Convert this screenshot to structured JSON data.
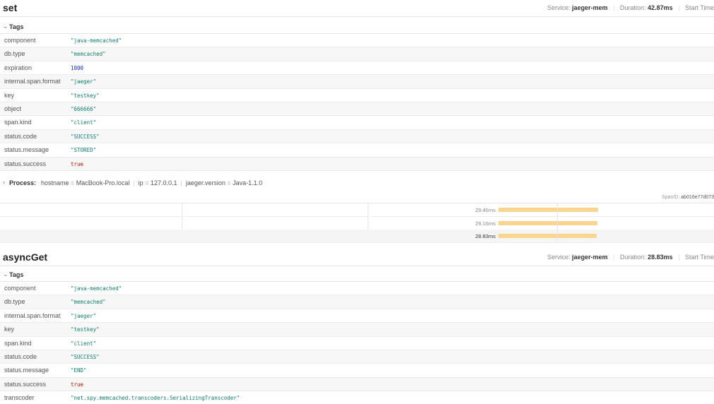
{
  "spans": [
    {
      "title": "set",
      "service_label": "Service:",
      "service": "jaeger-mem",
      "duration_label": "Duration:",
      "duration": "42.87ms",
      "start_label": "Start Time",
      "tags_label": "Tags",
      "tags": [
        {
          "key": "component",
          "value": "\"java-memcached\"",
          "type": "str"
        },
        {
          "key": "db.type",
          "value": "\"memcached\"",
          "type": "str"
        },
        {
          "key": "expiration",
          "value": "1000",
          "type": "num"
        },
        {
          "key": "internal.span.format",
          "value": "\"jaeger\"",
          "type": "str"
        },
        {
          "key": "key",
          "value": "\"testkey\"",
          "type": "str"
        },
        {
          "key": "object",
          "value": "\"666666\"",
          "type": "str"
        },
        {
          "key": "span.kind",
          "value": "\"client\"",
          "type": "str"
        },
        {
          "key": "status.code",
          "value": "\"SUCCESS\"",
          "type": "str"
        },
        {
          "key": "status.message",
          "value": "\"STORED\"",
          "type": "str"
        },
        {
          "key": "status.success",
          "value": "true",
          "type": "bool"
        }
      ],
      "process_label": "Process:",
      "process": [
        {
          "key": "hostname",
          "value": "MacBook-Pro.local"
        },
        {
          "key": "ip",
          "value": "127.0.0.1"
        },
        {
          "key": "jaeger.version",
          "value": "Java-1.1.0"
        }
      ],
      "span_id_label": "SpanID:",
      "span_id": "ab016e77d073"
    },
    {
      "title": "asyncGet",
      "service_label": "Service:",
      "service": "jaeger-mem",
      "duration_label": "Duration:",
      "duration": "28.83ms",
      "start_label": "Start Time",
      "tags_label": "Tags",
      "tags": [
        {
          "key": "component",
          "value": "\"java-memcached\"",
          "type": "str"
        },
        {
          "key": "db.type",
          "value": "\"memcached\"",
          "type": "str"
        },
        {
          "key": "internal.span.format",
          "value": "\"jaeger\"",
          "type": "str"
        },
        {
          "key": "key",
          "value": "\"testkey\"",
          "type": "str"
        },
        {
          "key": "span.kind",
          "value": "\"client\"",
          "type": "str"
        },
        {
          "key": "status.code",
          "value": "\"SUCCESS\"",
          "type": "str"
        },
        {
          "key": "status.message",
          "value": "\"END\"",
          "type": "str"
        },
        {
          "key": "status.success",
          "value": "true",
          "type": "bool"
        },
        {
          "key": "transcoder",
          "value": "\"net.spy.memcached.transcoders.SerializingTranscoder\"",
          "type": "str"
        }
      ]
    }
  ],
  "timeline": [
    {
      "duration": "29.46ms",
      "start_fraction": 0.698,
      "width_fraction": 0.14,
      "active": false
    },
    {
      "duration": "29.16ms",
      "start_fraction": 0.698,
      "width_fraction": 0.139,
      "active": false
    },
    {
      "duration": "28.83ms",
      "start_fraction": 0.698,
      "width_fraction": 0.138,
      "active": true
    }
  ],
  "colors": {
    "string_value": "#0a7e6e",
    "number_value": "#1525c5",
    "bool_value": "#c50d0d",
    "span_bar": "#fbd58f"
  },
  "icons": {
    "expanded": "chevron-down-icon",
    "collapsed": "chevron-right-icon"
  }
}
